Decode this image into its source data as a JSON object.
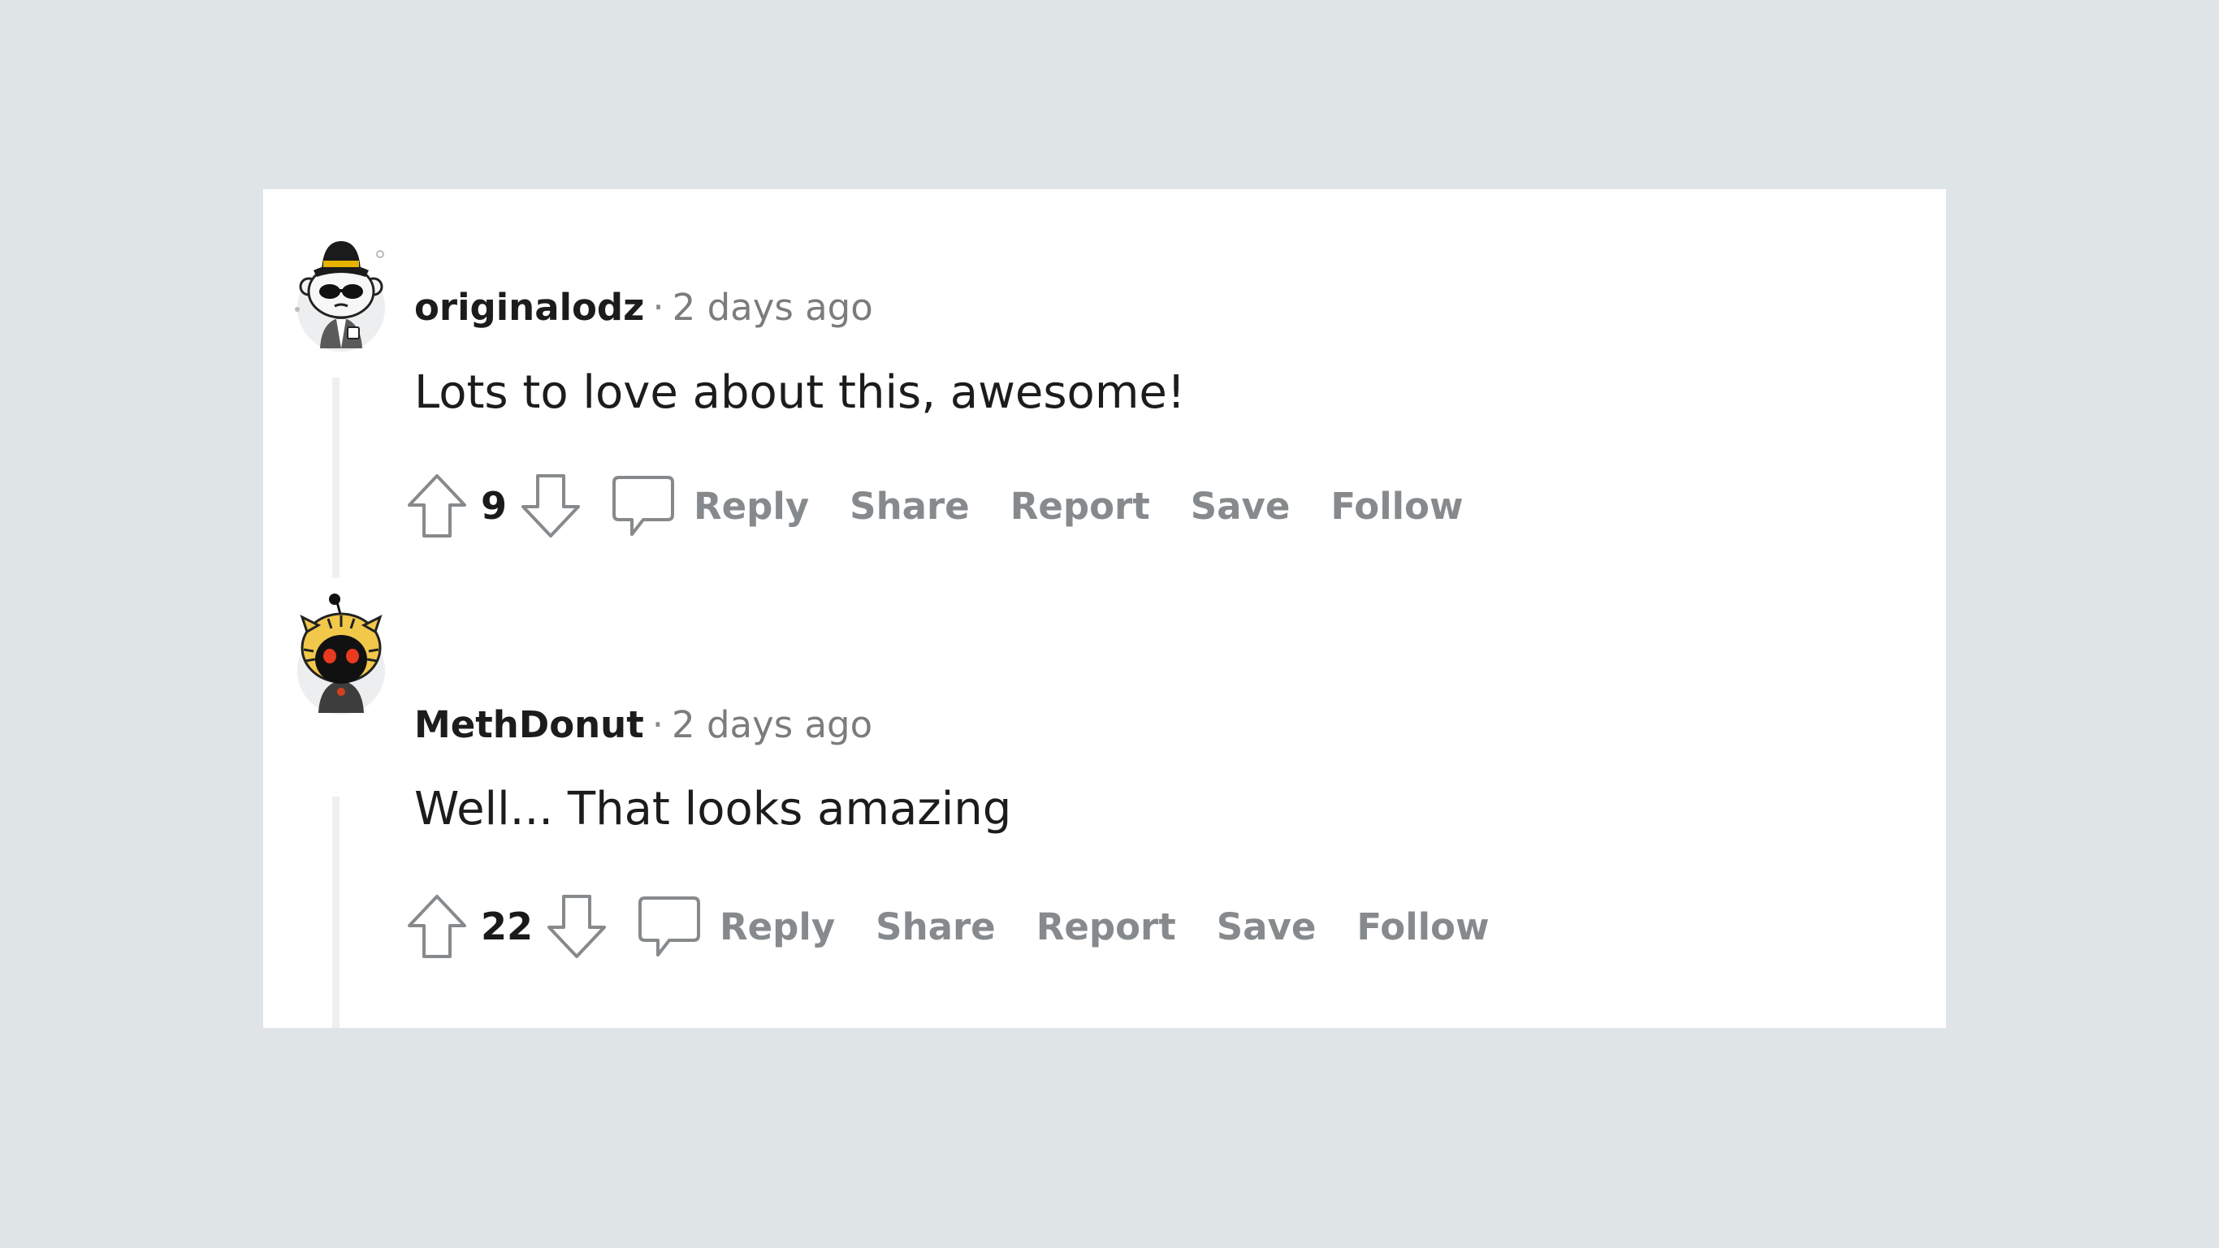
{
  "comments": [
    {
      "username": "originalodz",
      "separator": "·",
      "timestamp": "2 days ago",
      "body": "Lots to love about this, awesome!",
      "votes": "9",
      "avatar_icon": "snoo-fedora-sunglasses-avatar",
      "actions": {
        "reply": "Reply",
        "share": "Share",
        "report": "Report",
        "save": "Save",
        "follow": "Follow"
      }
    },
    {
      "username": "MethDonut",
      "separator": "·",
      "timestamp": "2 days ago",
      "body": "Well... That looks amazing",
      "votes": "22",
      "avatar_icon": "snoo-tiger-hood-avatar",
      "actions": {
        "reply": "Reply",
        "share": "Share",
        "report": "Report",
        "save": "Save",
        "follow": "Follow"
      }
    }
  ],
  "colors": {
    "page_background": "#dfe4e7",
    "card_background": "#ffffff",
    "action_text": "#878a8c",
    "body_text": "#1c1c1c",
    "thread_line": "#edeff1"
  }
}
